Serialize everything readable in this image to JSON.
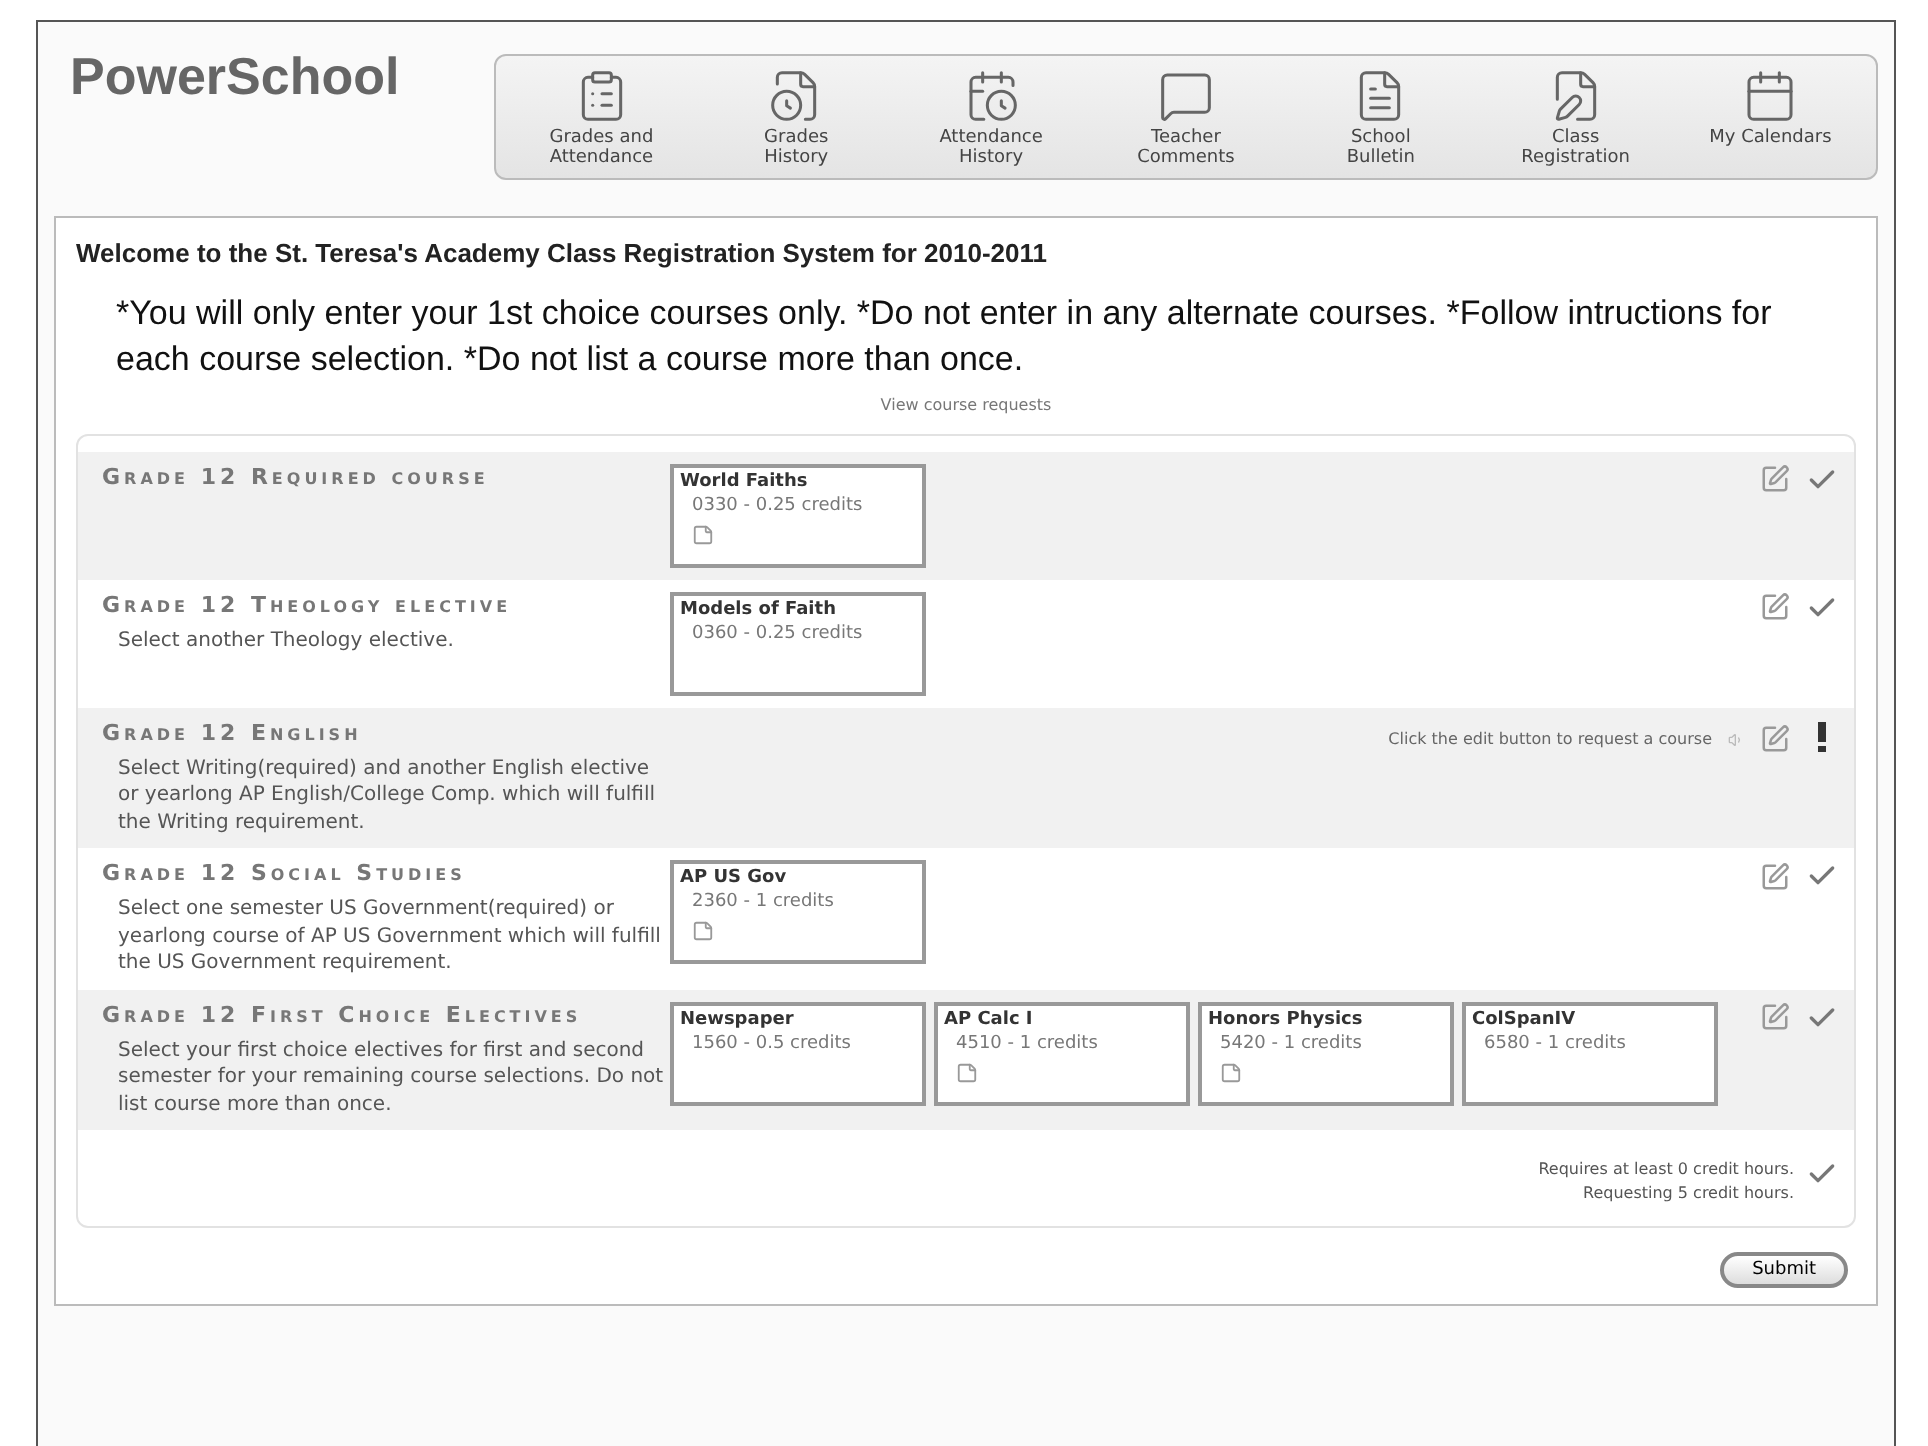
{
  "logo": "PowerSchool",
  "nav": [
    {
      "label": "Grades and Attendance"
    },
    {
      "label": "Grades History"
    },
    {
      "label": "Attendance History"
    },
    {
      "label": "Teacher Comments"
    },
    {
      "label": "School Bulletin"
    },
    {
      "label": "Class Registration"
    },
    {
      "label": "My Calendars"
    }
  ],
  "title": "Welcome to the St. Teresa's Academy Class Registration System for 2010-2011",
  "instructions": "*You will only enter your 1st choice courses only. *Do not enter in any alternate courses. *Follow intructions for each course selection. *Do not list a course more than once.",
  "view_link": "View course requests",
  "groups": [
    {
      "heading": "Grade 12 Required course",
      "complete": true,
      "courses": [
        {
          "name": "World Faiths",
          "detail": "0330 - 0.25 credits",
          "note": true
        }
      ]
    },
    {
      "heading": "Grade 12 Theology elective",
      "description": "Select another Theology elective.",
      "complete": true,
      "courses": [
        {
          "name": "Models of Faith",
          "detail": "0360 - 0.25 credits",
          "note": false
        }
      ]
    },
    {
      "heading": "Grade 12 English",
      "description": "Select Writing(required) and another English elective or yearlong AP English/College Comp. which will fulfill the Writing requirement.",
      "complete": false,
      "hint": "Click the edit button to request a course"
    },
    {
      "heading": "Grade 12 Social Studies",
      "description": "Select one semester US Government(required) or yearlong course of AP US Government which will fulfill the US Government requirement.",
      "complete": true,
      "courses": [
        {
          "name": "AP US Gov",
          "detail": "2360 - 1 credits",
          "note": true
        }
      ]
    },
    {
      "heading": "Grade 12 First Choice Electives",
      "description": "Select your first choice electives for first and second semester for your remaining course selections. Do not list course more than once.",
      "complete": true,
      "courses": [
        {
          "name": "Newspaper",
          "detail": "1560 - 0.5 credits",
          "note": false
        },
        {
          "name": "AP Calc I",
          "detail": "4510 - 1 credits",
          "note": true
        },
        {
          "name": "Honors Physics",
          "detail": "5420 - 1 credits",
          "note": true
        },
        {
          "name": "ColSpanIV",
          "detail": "6580 - 1 credits",
          "note": false
        }
      ]
    }
  ],
  "summary": {
    "required": "Requires at least 0 credit hours.",
    "requesting": "Requesting 5 credit hours.",
    "met": true
  },
  "submit": "Submit"
}
